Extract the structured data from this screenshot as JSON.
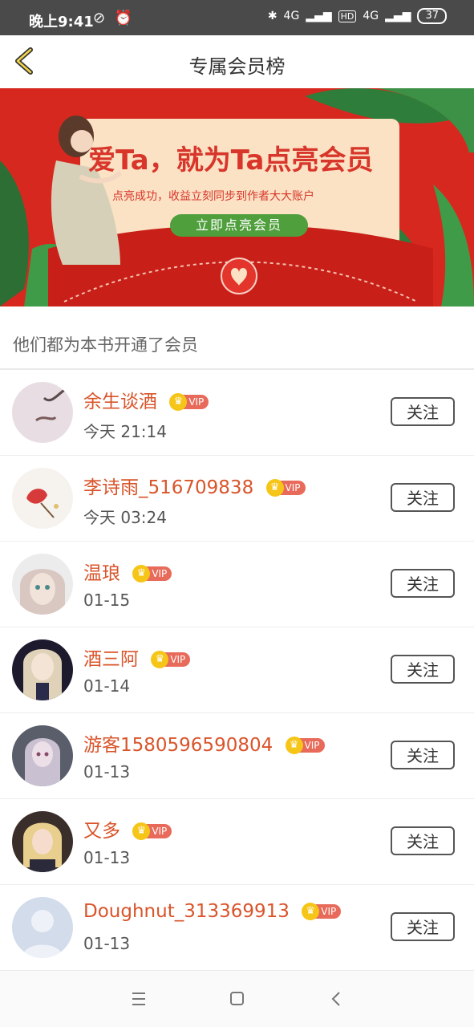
{
  "status": {
    "time": "晚上9:41",
    "battery": "37",
    "net1": "4G",
    "hd": "HD",
    "net2": "4G"
  },
  "header": {
    "title": "专属会员榜"
  },
  "banner": {
    "headline": "爱Ta，就为Ta点亮会员",
    "subline": "点亮成功，收益立刻同步到作者大大账户",
    "button": "立即点亮会员"
  },
  "section": {
    "title": "他们都为本书开通了会员"
  },
  "members": [
    {
      "name": "余生谈酒",
      "time": "今天 21:14",
      "vip": "VIP",
      "follow": "关注"
    },
    {
      "name": "李诗雨_516709838",
      "time": "今天 03:24",
      "vip": "VIP",
      "follow": "关注"
    },
    {
      "name": "温琅",
      "time": "01-15",
      "vip": "VIP",
      "follow": "关注"
    },
    {
      "name": "酒三阿",
      "time": "01-14",
      "vip": "VIP",
      "follow": "关注"
    },
    {
      "name": "游客1580596590804",
      "time": "01-13",
      "vip": "VIP",
      "follow": "关注"
    },
    {
      "name": "又多",
      "time": "01-13",
      "vip": "VIP",
      "follow": "关注"
    },
    {
      "name": "Doughnut_313369913",
      "time": "01-13",
      "vip": "VIP",
      "follow": "关注"
    }
  ],
  "colors": {
    "accent": "#d9542a",
    "banner_red": "#d7281f",
    "banner_card": "#fbe2c5",
    "button_green": "#4f9f3c"
  },
  "icons": [
    "back-arrow-icon",
    "menu-icon",
    "home-icon",
    "back-nav-icon",
    "bluetooth-icon",
    "alarm-icon"
  ]
}
